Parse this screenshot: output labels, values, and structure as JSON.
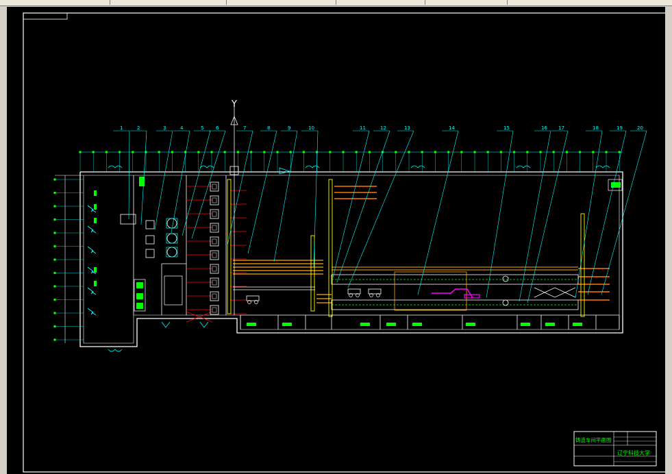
{
  "colors": {
    "background": "#000000",
    "frame": "#ffffff",
    "leader": "#00ffff",
    "equipment": "#00ff00",
    "pipe": "#ff0000",
    "rail": "#ffaa00",
    "magenta": "#ff00ff"
  },
  "drawing": {
    "axis_label": "Y",
    "callouts": [
      "1",
      "2",
      "3",
      "4",
      "5",
      "6",
      "7",
      "8",
      "9",
      "10",
      "11",
      "12",
      "13",
      "14",
      "15",
      "16",
      "17",
      "18",
      "19",
      "20"
    ]
  },
  "title_block": {
    "drawing_title": "铸造车间平面图",
    "school": "辽宁科技大学"
  }
}
